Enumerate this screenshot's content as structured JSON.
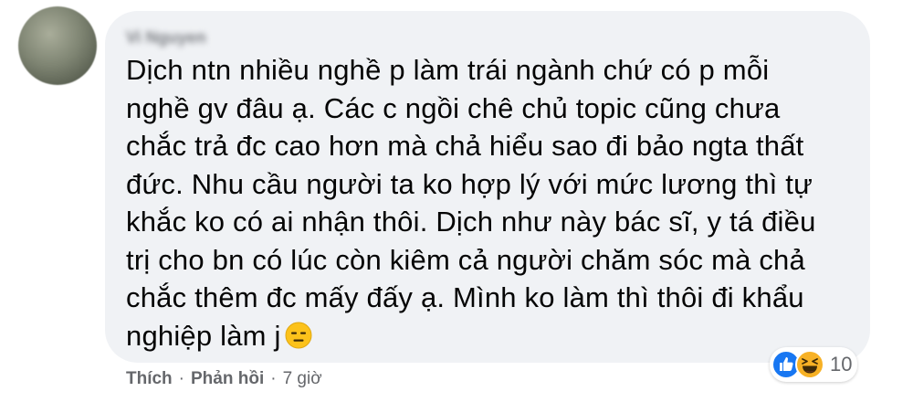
{
  "comment": {
    "author_name": "Vi Nguyen",
    "text_lines": [
      "Dịch ntn nhiều nghề p làm trái ngành chứ có p mỗi",
      "nghề gv đâu ạ. Các c ngồi chê chủ topic cũng chưa",
      "chắc trả đc cao hơn mà chả hiểu sao đi bảo ngta thất",
      "đức. Nhu cầu người ta ko hợp lý với mức lương thì tự",
      "khắc ko có ai nhận thôi. Dịch như này bác sĩ, y tá điều",
      "trị cho bn có lúc còn kiêm cả người chăm sóc mà chả",
      "chắc thêm đc mấy đấy ạ. Mình ko làm thì thôi đi khẩu",
      "nghiệp làm j"
    ],
    "trailing_emoji": "expressionless-face-emoji"
  },
  "reactions": {
    "icons": [
      "like-icon",
      "haha-icon"
    ],
    "count": "10"
  },
  "actions": {
    "like_label": "Thích",
    "separator": "·",
    "reply_label": "Phản hồi",
    "time": "7 giờ"
  },
  "colors": {
    "bubble_bg": "#f0f2f5",
    "text": "#050505",
    "meta_text": "#65676b",
    "like_blue": "#1877f2",
    "haha_yellow": "#f7b125"
  }
}
